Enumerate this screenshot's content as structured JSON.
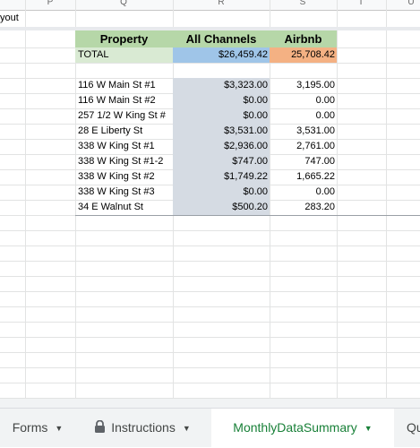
{
  "columns": [
    "P",
    "Q",
    "R",
    "S",
    "T",
    "U"
  ],
  "partial_cell_text": "yout",
  "table": {
    "headers": {
      "property": "Property",
      "all_channels": "All Channels",
      "airbnb": "Airbnb"
    },
    "total": {
      "label": "TOTAL",
      "all_channels": "$26,459.42",
      "airbnb": "25,708.42"
    },
    "rows": [
      {
        "property": "116 W Main St #1",
        "all_channels": "$3,323.00",
        "airbnb": "3,195.00"
      },
      {
        "property": "116 W Main St #2",
        "all_channels": "$0.00",
        "airbnb": "0.00"
      },
      {
        "property": "257 1/2 W King St #",
        "all_channels": "$0.00",
        "airbnb": "0.00"
      },
      {
        "property": "28 E Liberty St",
        "all_channels": "$3,531.00",
        "airbnb": "3,531.00"
      },
      {
        "property": "338 W King St #1",
        "all_channels": "$2,936.00",
        "airbnb": "2,761.00"
      },
      {
        "property": "338 W King St #1-2",
        "all_channels": "$747.00",
        "airbnb": "747.00"
      },
      {
        "property": "338 W King St #2",
        "all_channels": "$1,749.22",
        "airbnb": "1,665.22"
      },
      {
        "property": "338 W King St #3",
        "all_channels": "$0.00",
        "airbnb": "0.00"
      },
      {
        "property": "34 E Walnut St",
        "all_channels": "$500.20",
        "airbnb": "283.20"
      }
    ]
  },
  "tabs": [
    {
      "label": "Forms",
      "icon": "none",
      "active": false
    },
    {
      "label": "Instructions",
      "icon": "lock-icon",
      "active": false
    },
    {
      "label": "MonthlyDataSummary",
      "icon": "none",
      "active": true
    },
    {
      "label": "Qu",
      "icon": "none",
      "active": false
    }
  ],
  "colors": {
    "header_green": "#b6d7a8",
    "total_label_bg": "#d9ead3",
    "total_all_bg": "#9fc5e8",
    "total_airbnb_bg": "#f4b183",
    "data_gray": "#d5dbe3",
    "active_tab_text": "#188038"
  }
}
